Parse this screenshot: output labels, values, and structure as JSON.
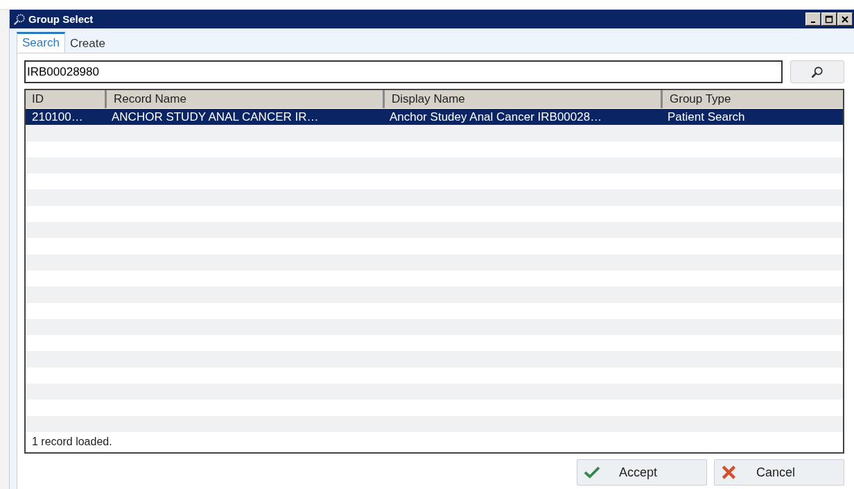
{
  "window": {
    "title": "Group Select"
  },
  "tabs": [
    {
      "label": "Search",
      "selected": true
    },
    {
      "label": "Create",
      "selected": false
    }
  ],
  "search": {
    "value": "IRB00028980"
  },
  "table": {
    "columns": [
      "ID",
      "Record Name",
      "Display Name",
      "Group Type"
    ],
    "rows": [
      {
        "cells": [
          "210100…",
          "ANCHOR STUDY ANAL CANCER IR…",
          "Anchor Studey Anal Cancer IRB00028…",
          "Patient Search"
        ],
        "selected": true
      }
    ]
  },
  "status_bar": "1 record loaded.",
  "buttons": [
    {
      "kind": "accept",
      "label": "Accept"
    },
    {
      "kind": "cancel",
      "label": "Cancel"
    }
  ]
}
